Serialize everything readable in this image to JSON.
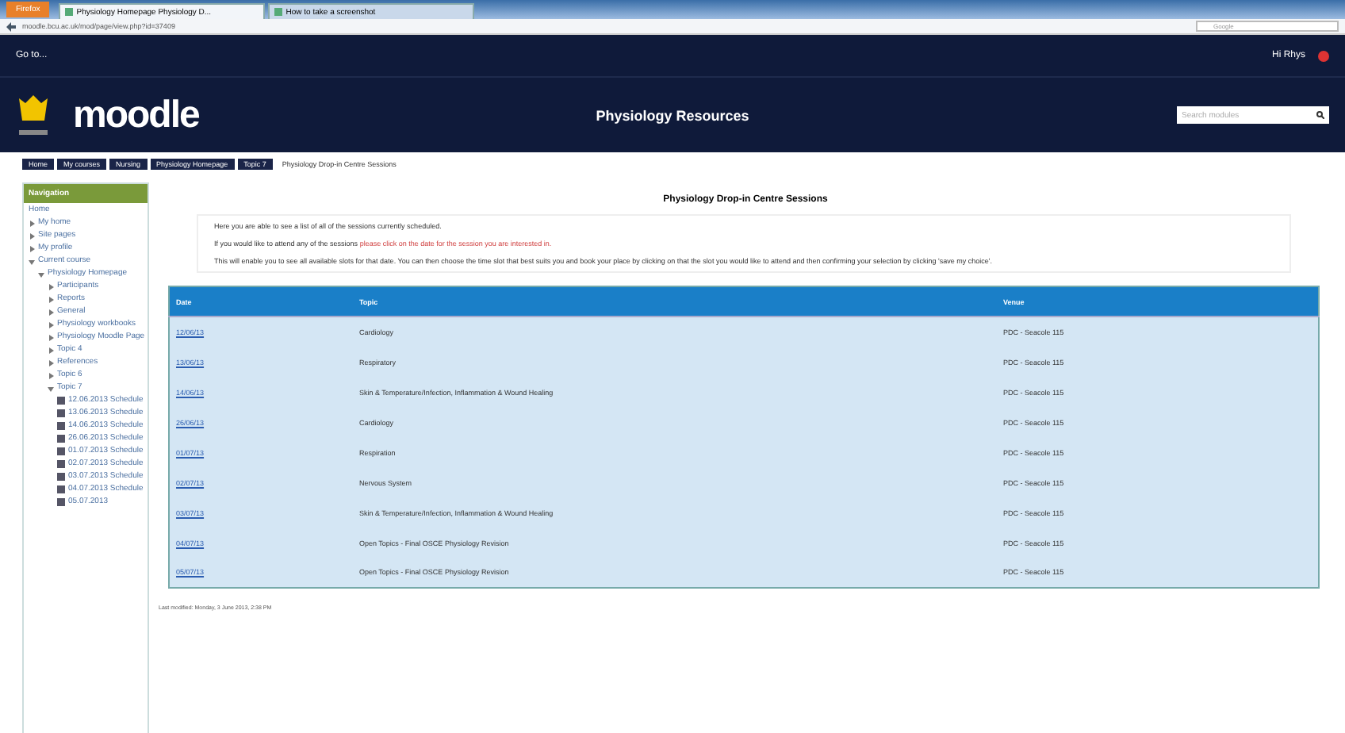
{
  "browser": {
    "menu_button": "Firefox",
    "tabs": [
      {
        "title": "Physiology Homepage Physiology D...",
        "selected": true
      },
      {
        "title": "How to take a screenshot",
        "selected": false
      }
    ],
    "address": "moodle.bcu.ac.uk/mod/page/view.php?id=37409",
    "search_placeholder": "Google"
  },
  "top_bar": {
    "go_to": "Go to...",
    "user": "Hi Rhys"
  },
  "header": {
    "logo": "moodle",
    "title": "Physiology Resources",
    "search_placeholder": "Search modules"
  },
  "breadcrumb": [
    {
      "label": "Home"
    },
    {
      "label": "My courses"
    },
    {
      "label": "Nursing"
    },
    {
      "label": "Physiology Homepage"
    },
    {
      "label": "Topic 7"
    },
    {
      "label": "Physiology Drop-in Centre Sessions"
    }
  ],
  "sidebar": {
    "title": "Navigation",
    "items": [
      {
        "kind": "plain",
        "label": "Home"
      },
      {
        "kind": "branch",
        "label": "My home",
        "expanded": false
      },
      {
        "kind": "branch",
        "label": "Site pages",
        "expanded": false
      },
      {
        "kind": "branch",
        "label": "My profile",
        "expanded": false
      },
      {
        "kind": "branch",
        "label": "Current course",
        "expanded": true,
        "children": [
          {
            "kind": "branch",
            "label": "Physiology Homepage",
            "expanded": true,
            "children": [
              {
                "kind": "branch",
                "label": "Participants",
                "expanded": false
              },
              {
                "kind": "branch",
                "label": "Reports",
                "expanded": false
              },
              {
                "kind": "branch",
                "label": "General",
                "expanded": false
              },
              {
                "kind": "branch",
                "label": "Physiology workbooks",
                "expanded": false
              },
              {
                "kind": "branch",
                "label": "Physiology Moodle Page",
                "expanded": false
              },
              {
                "kind": "branch",
                "label": "Topic 4",
                "expanded": false
              },
              {
                "kind": "branch",
                "label": "References",
                "expanded": false
              },
              {
                "kind": "branch",
                "label": "Topic 6",
                "expanded": false
              },
              {
                "kind": "branch",
                "label": "Topic 7",
                "expanded": true,
                "children": [
                  {
                    "kind": "schedule",
                    "label": "12.06.2013 Schedule"
                  },
                  {
                    "kind": "schedule",
                    "label": "13.06.2013 Schedule"
                  },
                  {
                    "kind": "schedule",
                    "label": "14.06.2013 Schedule"
                  },
                  {
                    "kind": "schedule",
                    "label": "26.06.2013 Schedule"
                  },
                  {
                    "kind": "schedule",
                    "label": "01.07.2013 Schedule"
                  },
                  {
                    "kind": "schedule",
                    "label": "02.07.2013 Schedule"
                  },
                  {
                    "kind": "schedule",
                    "label": "03.07.2013 Schedule"
                  },
                  {
                    "kind": "schedule",
                    "label": "04.07.2013 Schedule"
                  },
                  {
                    "kind": "schedule",
                    "label": "05.07.2013"
                  }
                ]
              }
            ]
          }
        ]
      }
    ]
  },
  "main": {
    "title": "Physiology Drop-in Centre Sessions",
    "intro": [
      {
        "text": "Here you are able to see a list of all of the sessions currently scheduled."
      },
      {
        "text": "If you would like to attend any of the sessions",
        "highlight": "please click on the date for the session you are interested in."
      },
      {
        "text": "This will enable you to see all available slots for that date. You can then choose the time slot that best suits you and book your place by clicking on that the slot you would like to attend and then confirming your selection by clicking 'save my choice'."
      }
    ],
    "table": {
      "columns": [
        "Date",
        "Topic",
        "Venue"
      ],
      "rows": [
        [
          "12/06/13",
          "Cardiology",
          "PDC - Seacole 115"
        ],
        [
          "13/06/13",
          "Respiratory",
          "PDC - Seacole 115"
        ],
        [
          "14/06/13",
          "Skin & Temperature/Infection, Inflammation & Wound Healing",
          "PDC - Seacole 115"
        ],
        [
          "26/06/13",
          "Cardiology",
          "PDC - Seacole 115"
        ],
        [
          "01/07/13",
          "Respiration",
          "PDC - Seacole 115"
        ],
        [
          "02/07/13",
          "Nervous System",
          "PDC - Seacole 115"
        ],
        [
          "03/07/13",
          "Skin & Temperature/Infection, Inflammation & Wound Healing",
          "PDC - Seacole 115"
        ],
        [
          "04/07/13",
          "Open Topics - Final OSCE Physiology Revision",
          "PDC - Seacole 115"
        ],
        [
          "05/07/13",
          "Open Topics - Final OSCE Physiology Revision",
          "PDC - Seacole 115"
        ]
      ]
    },
    "footer": "Last modified: Monday, 3 June 2013, 2:38 PM"
  }
}
